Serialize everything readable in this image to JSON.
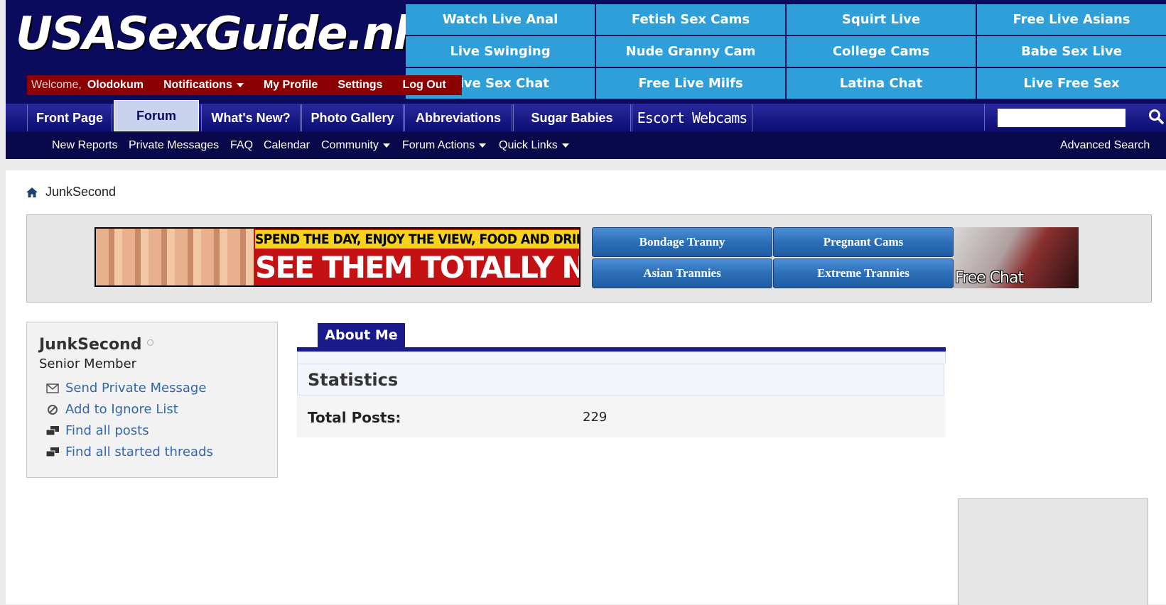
{
  "header": {
    "logo_text": "USASexGuide.nl",
    "ad_grid": [
      "Watch Live Anal",
      "Fetish Sex Cams",
      "Squirt Live",
      "Free Live Asians",
      "Live Swinging",
      "Nude Granny Cam",
      "College Cams",
      "Babe Sex Live",
      "Live Sex Chat",
      "Free Live Milfs",
      "Latina Chat",
      "Live Free Sex"
    ]
  },
  "userbar": {
    "welcome": "Welcome,",
    "username": "Olodokum",
    "notifications": "Notifications",
    "my_profile": "My Profile",
    "settings": "Settings",
    "logout": "Log Out"
  },
  "nav": {
    "tabs": [
      "Front Page",
      "Forum",
      "What's New?",
      "Photo Gallery",
      "Abbreviations",
      "Sugar Babies",
      "Escort Webcams"
    ],
    "active_tab": "Forum",
    "search_placeholder": ""
  },
  "subnav": {
    "links": [
      "New Reports",
      "Private Messages",
      "FAQ",
      "Calendar",
      "Community",
      "Forum Actions",
      "Quick Links"
    ],
    "advanced_search": "Advanced Search"
  },
  "breadcrumb": {
    "current": "JunkSecond"
  },
  "ads": {
    "banner_line1": "SPEND THE DAY, ENJOY THE VIEW, FOOD AND DRINK",
    "banner_line2": "SEE THEM TOTALLY NUDE",
    "buttons": [
      "Bondage Tranny",
      "Pregnant Cams",
      "Asian Trannies",
      "Extreme Trannies"
    ],
    "free_chat": "Free Chat"
  },
  "profile": {
    "username": "JunkSecond",
    "title": "Senior Member",
    "links": [
      "Send Private Message",
      "Add to Ignore List",
      "Find all posts",
      "Find all started threads"
    ]
  },
  "about": {
    "tab_label": "About Me",
    "stats_title": "Statistics",
    "total_posts_label": "Total Posts:",
    "total_posts_value": "229"
  },
  "colors": {
    "header_bg": "#0b0b5e",
    "ad_cell": "#2e9fd8",
    "userbar_bg": "#8b0000",
    "link_blue": "#3366aa"
  }
}
